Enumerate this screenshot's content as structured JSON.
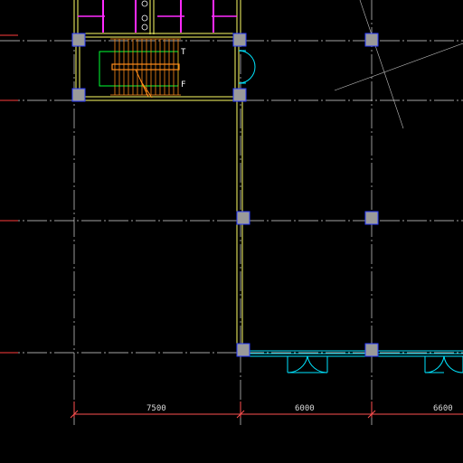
{
  "colors": {
    "background": "#000000",
    "grid": "#d9d9d9",
    "wall": "#ffff66",
    "column": "#9a9a9a",
    "column_edge": "#2a3cff",
    "door": "#00e5ff",
    "stair": "#ff8c1a",
    "stair_inner": "#00ff33",
    "magenta": "#ff2aff",
    "dimension": "#ff5050",
    "text": "#d8d8d8"
  },
  "dimensions": [
    {
      "label": "7500"
    },
    {
      "label": "6000"
    },
    {
      "label": "6600"
    }
  ],
  "stair_marks": {
    "up": "T",
    "down": "F"
  }
}
